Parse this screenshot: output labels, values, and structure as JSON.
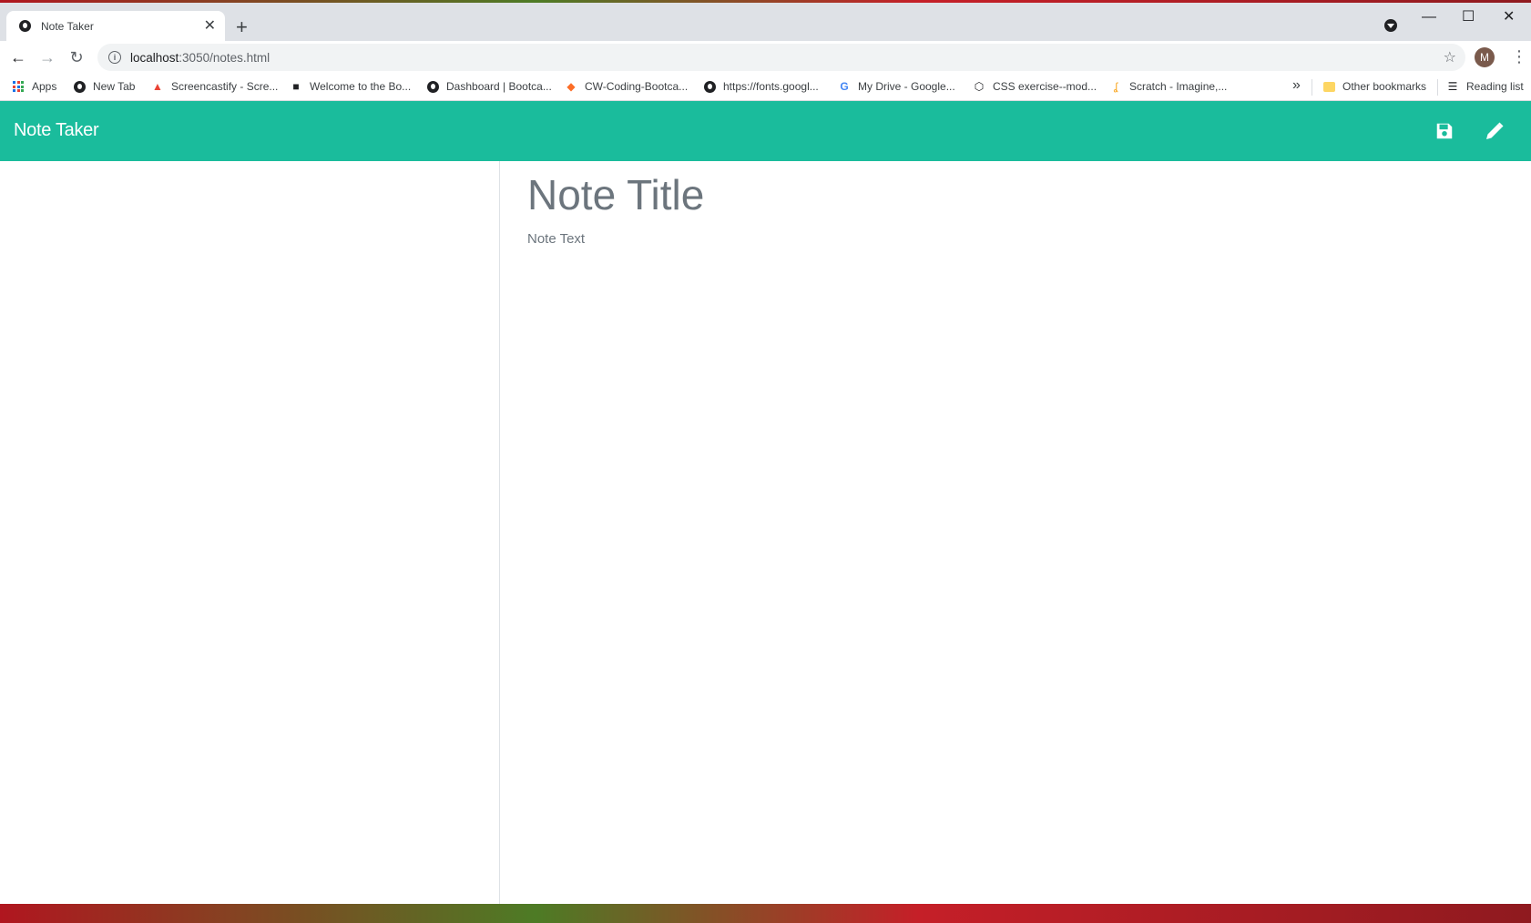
{
  "browser": {
    "tab": {
      "title": "Note Taker",
      "close": "✕"
    },
    "new_tab": "+",
    "window_controls": {
      "minimize": "—",
      "maximize": "☐",
      "close": "✕"
    },
    "url_host": "localhost",
    "url_rest": ":3050/notes.html",
    "avatar_initial": "M",
    "bookmarks": [
      {
        "label": "Apps",
        "icon": "apps-grid-icon"
      },
      {
        "label": "New Tab",
        "icon": "globe-icon"
      },
      {
        "label": "Screencastify - Scre...",
        "icon": "screencastify-icon"
      },
      {
        "label": "Welcome to the Bo...",
        "icon": "book-icon"
      },
      {
        "label": "Dashboard | Bootca...",
        "icon": "globe-icon"
      },
      {
        "label": "CW-Coding-Bootca...",
        "icon": "gitlab-icon"
      },
      {
        "label": "https://fonts.googl...",
        "icon": "globe-icon"
      },
      {
        "label": "My Drive - Google...",
        "icon": "google-icon"
      },
      {
        "label": "CSS exercise--mod...",
        "icon": "codepen-icon"
      },
      {
        "label": "Scratch - Imagine,...",
        "icon": "scratch-icon"
      }
    ],
    "more_bookmarks": "»",
    "other_bookmarks": "Other bookmarks",
    "reading_list": "Reading list"
  },
  "app": {
    "brand": "Note Taker",
    "save_icon": "save-icon",
    "new_note_icon": "pencil-icon",
    "accent_color": "#1abc9c"
  },
  "editor": {
    "title_placeholder": "Note Title",
    "text_placeholder": "Note Text"
  }
}
